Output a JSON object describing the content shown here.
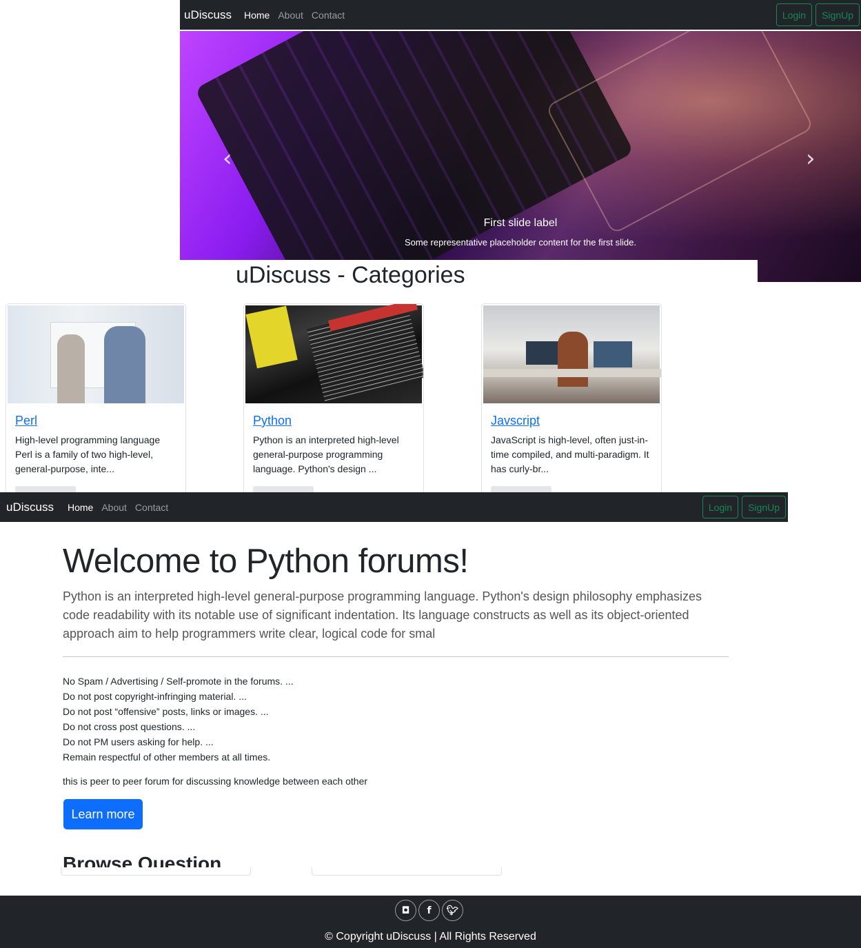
{
  "navbar": {
    "brand": "uDiscuss",
    "links": [
      "Home",
      "About",
      "Contact"
    ],
    "login": "Login",
    "signup": "SignUp"
  },
  "carousel": {
    "prev_icon": "‹",
    "next_icon": "›",
    "caption_title": "First slide label",
    "caption_text": "Some representative placeholder content for the first slide."
  },
  "categories": {
    "title": "uDiscuss - Categories",
    "cards": [
      {
        "title": "Perl",
        "text": "High-level programming language Perl is a family of two high-level, general-purpose, inte..."
      },
      {
        "title": "Python",
        "text": "Python is an interpreted high-level general-purpose programming language. Python's design ..."
      },
      {
        "title": "Javscript",
        "text": "JavaScript is high-level, often just-in-time compiled, and multi-paradigm. It has curly-br..."
      }
    ]
  },
  "forum": {
    "heading": "Welcome to Python forums!",
    "lead": "Python is an interpreted high-level general-purpose programming language. Python's design philosophy emphasizes code readability with its notable use of significant indentation. Its language constructs as well as its object-oriented approach aim to help programmers write clear, logical code for smal",
    "rules": [
      "No Spam / Advertising / Self-promote in the forums. ...",
      "Do not post copyright-infringing material. ...",
      "Do not post “offensive” posts, links or images. ...",
      "Do not cross post questions. ...",
      "Do not PM users asking for help. ...",
      "Remain respectful of other members at all times."
    ],
    "note": "this is peer to peer forum for discussing knowledge between each other",
    "learn_more": "Learn more",
    "browse_heading": "Browse Question"
  },
  "footer": {
    "icons": [
      "instagram-icon",
      "facebook-icon",
      "twitter-icon"
    ],
    "copyright": "© Copyright uDiscuss | All Rights Reserved"
  },
  "colors": {
    "navbar_bg": "#212529",
    "outline_success": "#198754",
    "primary": "#0d6efd"
  }
}
